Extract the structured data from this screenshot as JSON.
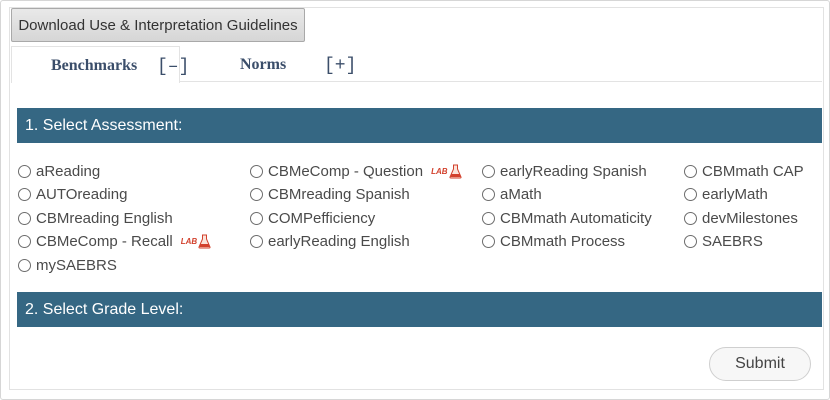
{
  "toolbar": {
    "download_label": "Download Use & Interpretation Guidelines"
  },
  "tabs": [
    {
      "label": "Benchmarks",
      "toggle": "[–]",
      "active": true
    },
    {
      "label": "Norms",
      "toggle": "[+]",
      "active": false
    }
  ],
  "sections": {
    "assessment": "1. Select Assessment:",
    "grade": "2. Select Grade Level:"
  },
  "assessments": {
    "col1": [
      "aReading",
      "AUTOreading",
      "CBMreading English",
      "CBMeComp - Recall",
      "mySAEBRS"
    ],
    "col2": [
      "CBMeComp - Question",
      "CBMreading Spanish",
      "COMPefficiency",
      "earlyReading English"
    ],
    "col3": [
      "earlyReading Spanish",
      "aMath",
      "CBMmath Automaticity",
      "CBMmath Process"
    ],
    "col4": [
      "CBMmath CAP",
      "earlyMath",
      "devMilestones",
      "SAEBRS"
    ]
  },
  "badges": {
    "lab_text": "LAB",
    "lab_icon": "flask-icon"
  },
  "footer": {
    "submit_label": "Submit"
  },
  "colors": {
    "section_bar": "#356783",
    "tab_text": "#3b4e6a",
    "lab_badge": "#d2402c"
  }
}
